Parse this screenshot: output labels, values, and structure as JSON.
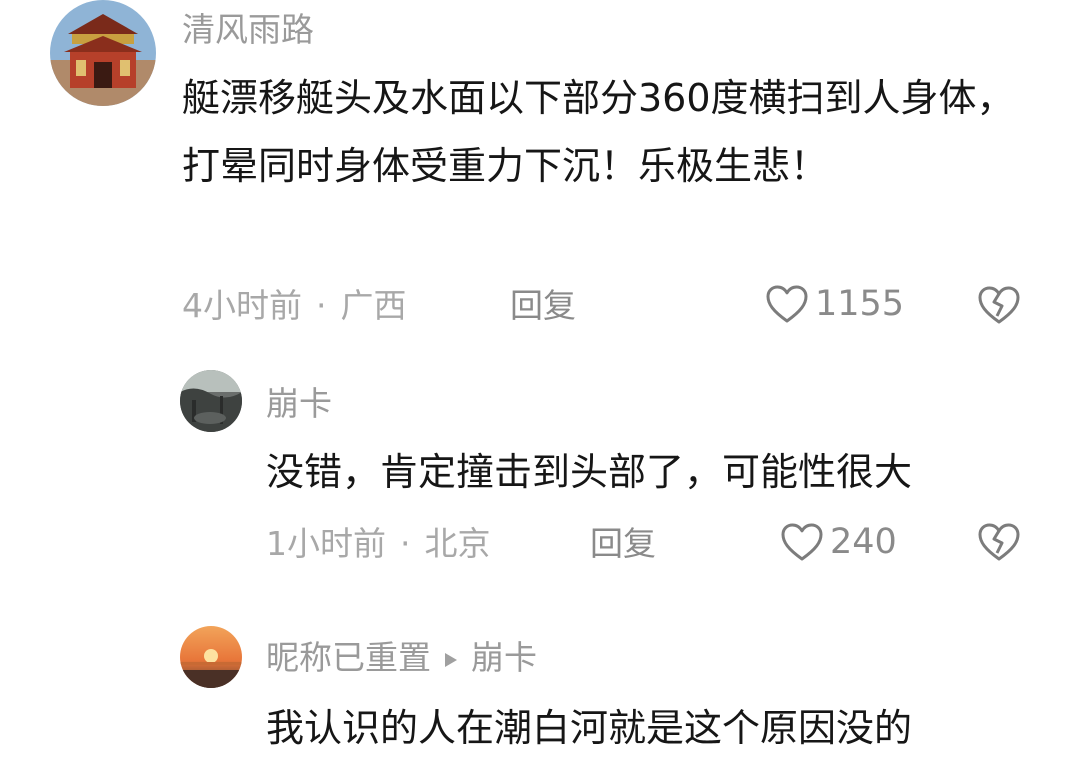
{
  "comments": [
    {
      "username": "清风雨路",
      "content": "艇漂移艇头及水面以下部分360度横扫到人身体，打晕同时身体受重力下沉！乐极生悲！",
      "time": "4小时前",
      "location": "广西",
      "reply_label": "回复",
      "likes": "1155"
    },
    {
      "username": "崩卡",
      "content": "没错，肯定撞击到头部了，可能性很大",
      "time": "1小时前",
      "location": "北京",
      "reply_label": "回复",
      "likes": "240"
    },
    {
      "username": "昵称已重置",
      "reply_to": "崩卡",
      "content": "我认识的人在潮白河就是这个原因没的"
    }
  ],
  "meta_separator": "·",
  "icons": {
    "like": "heart-outline-icon",
    "dislike": "broken-heart-icon",
    "reply_to": "triangle-right-icon"
  },
  "colors": {
    "text_primary": "#161616",
    "text_secondary": "#9a9a9a",
    "background": "#ffffff"
  }
}
